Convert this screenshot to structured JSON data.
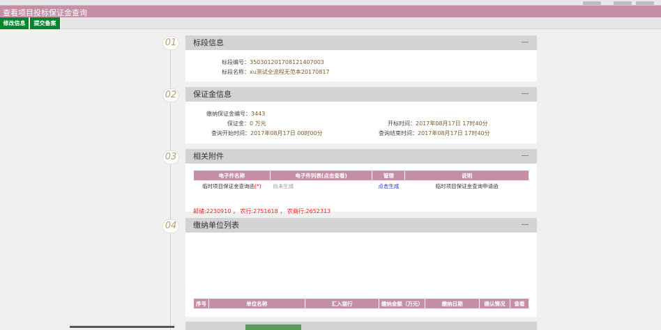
{
  "window": {
    "title": "查看项目投标保证金查询"
  },
  "toolbar": {
    "edit_label": "修改信息",
    "submit_label": "提交备案"
  },
  "sections": [
    {
      "num": "01",
      "title": "标段信息"
    },
    {
      "num": "02",
      "title": "保证金信息"
    },
    {
      "num": "03",
      "title": "相关附件"
    },
    {
      "num": "04",
      "title": "缴纳单位列表"
    }
  ],
  "section_info": {
    "code_label": "标段编号：",
    "code_value": "350301201708121407003",
    "name_label": "标段名称：",
    "name_value": "xu测试全流程无范本20170817"
  },
  "deposit": {
    "no_label": "缴纳保证金编号：",
    "no_value": "3443",
    "amount_label": "保证金：",
    "amount_value": "0 万元",
    "open_label": "开标时间：",
    "open_value": "2017年08月17日 17时40分",
    "qstart_label": "查询开始时间：",
    "qstart_value": "2017年08月17日 00时00分",
    "qend_label": "查询结束时间：",
    "qend_value": "2017年08月17日 17时40分"
  },
  "attachments": {
    "headers": [
      "电子件名称",
      "电子件列表(点击查看)",
      "管理",
      "说明"
    ],
    "row": {
      "name": "临时项目保证金查询函",
      "required": "(*)",
      "list": "尚未生成",
      "manage": "点击生成",
      "desc": "临时项目保证金查询申请函"
    },
    "note": "邮储:2230910 ， 农行:2751618 ， 农商行:2652313"
  },
  "units": {
    "headers": [
      "序号",
      "单位名称",
      "汇入银行",
      "缴纳金额（万元）",
      "缴纳日期",
      "确认情况",
      "查看"
    ]
  },
  "colors": {
    "accent": "#c48fa6",
    "green": "#00852d",
    "note": "#e02020"
  }
}
